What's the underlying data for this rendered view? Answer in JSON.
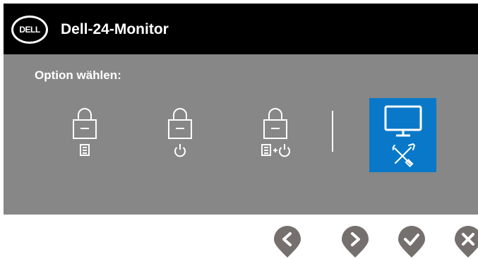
{
  "header": {
    "brand": "DELL",
    "title": "Dell-24-Monitor"
  },
  "menu": {
    "prompt": "Option wählen:",
    "options": [
      {
        "icon": "lock-menu-icon",
        "state": "locked"
      },
      {
        "icon": "lock-power-icon",
        "state": "locked"
      },
      {
        "icon": "lock-menu-power-icon",
        "state": "locked"
      },
      {
        "icon": "system-diagnostics-icon",
        "state": "selected"
      }
    ]
  },
  "navigation": {
    "buttons": [
      "left-arrow-icon",
      "right-arrow-icon",
      "checkmark-icon",
      "close-icon"
    ]
  },
  "colors": {
    "title_bar": "#000000",
    "panel": "#878787",
    "selected": "#0a78c8",
    "nav_buttons": "#75706d"
  }
}
